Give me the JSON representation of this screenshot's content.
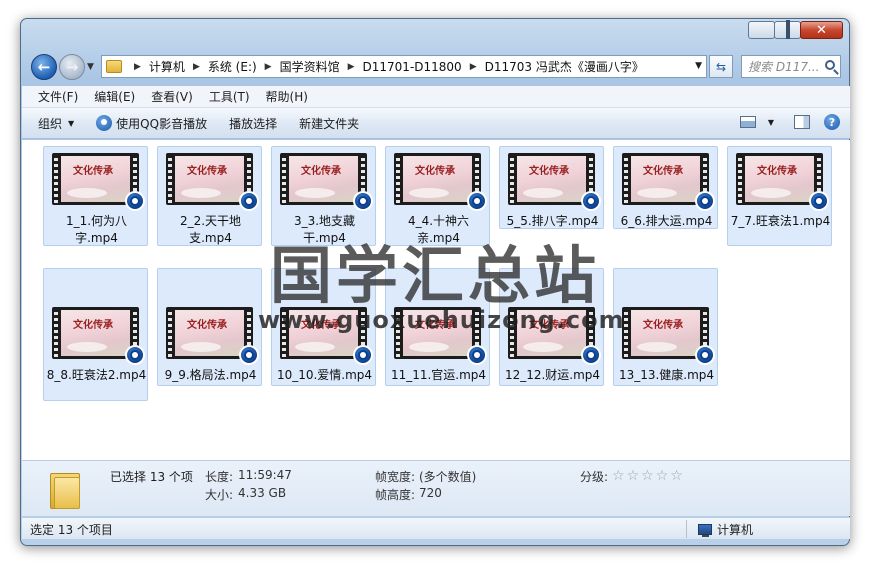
{
  "window": {
    "controls": [
      "minimize",
      "maximize",
      "close"
    ]
  },
  "address": {
    "breadcrumbs": [
      "计算机",
      "系统 (E:)",
      "国学资料馆",
      "D11701-D11800",
      "D11703 冯武杰《漫画八字》"
    ],
    "search_placeholder": "搜索 D117..."
  },
  "menu": [
    "文件(F)",
    "编辑(E)",
    "查看(V)",
    "工具(T)",
    "帮助(H)"
  ],
  "toolbar": {
    "organize": "组织",
    "play_qq": "使用QQ影音播放",
    "play_selection": "播放选择",
    "new_folder": "新建文件夹"
  },
  "thumbnail_text": "文化传承",
  "files": [
    {
      "label": "1_1.何为八字.mp4"
    },
    {
      "label": "2_2.天干地支.mp4"
    },
    {
      "label": "3_3.地支藏干.mp4"
    },
    {
      "label": "4_4.十神六亲.mp4"
    },
    {
      "label": "5_5.排八字.mp4"
    },
    {
      "label": "6_6.排大运.mp4"
    },
    {
      "label": "7_7.旺衰法1.mp4"
    },
    {
      "label": "8_8.旺衰法2.mp4"
    },
    {
      "label": "9_9.格局法.mp4"
    },
    {
      "label": "10_10.爱情.mp4"
    },
    {
      "label": "11_11.官运.mp4"
    },
    {
      "label": "12_12.财运.mp4"
    },
    {
      "label": "13_13.健康.mp4"
    }
  ],
  "watermark": {
    "title": "国学汇总站",
    "url": "www.guoxuehuizong.com"
  },
  "details": {
    "selected": "已选择 13 个项",
    "length_label": "长度:",
    "length_value": "11:59:47",
    "size_label": "大小:",
    "size_value": "4.33 GB",
    "frame_width_label": "帧宽度:",
    "frame_width_value": "(多个数值)",
    "frame_height_label": "帧高度:",
    "frame_height_value": "720",
    "rating_label": "分级:",
    "rating_stars": 0,
    "rating_max": 5
  },
  "status": {
    "left": "选定 13 个项目",
    "right": "计算机"
  }
}
